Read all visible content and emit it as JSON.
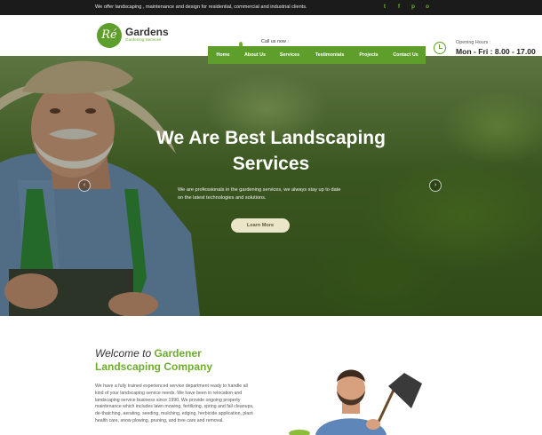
{
  "topbar": {
    "message": "We offer landscaping , maintenance and design for residential, commercial and industrial clients.",
    "social_icons": [
      "twitter-icon",
      "facebook-icon",
      "pinterest-icon",
      "instagram-icon"
    ],
    "social_glyphs": [
      "t",
      "f",
      "p",
      "o"
    ]
  },
  "header": {
    "logo_letters": "Ré",
    "logo_name": "Gardens",
    "logo_tagline": "Gardening Services",
    "call_label": "Call us now :",
    "opening_label": "Opening Hours :",
    "opening_hours": "Mon - Fri : 8.00 - 17.00"
  },
  "nav": {
    "items": [
      "Home",
      "About Us",
      "Services",
      "Testimonials",
      "Projects",
      "Contact Us"
    ]
  },
  "hero": {
    "title_line1": "We Are Best Landscaping",
    "title_line2": "Services",
    "text": "We are professionals in the gardening services, we always stay up to date on the latest technologies and solutions.",
    "button": "Learn More",
    "prev_glyph": "‹",
    "next_glyph": "›"
  },
  "welcome": {
    "line1_prefix": "Welcome to ",
    "line1_accent": "Gardener",
    "line2": "Landscaping Company",
    "text": "We have a fully trained experienced service department ready to handle all kind of your landscaping service needs. We have been in relocation and landscaping service business since 1990. We provide ongoing property maintenance which includes lawn mowing, fertilizing, spring and fall cleanups, de-thatching, aerating, seeding, mulching, edging, herbicide application, plant health care, snow plowing, pruning, and tree care and removal."
  },
  "colors": {
    "accent": "#5e9e2a",
    "topbar": "#1b1b1b",
    "button": "#ece6c9"
  }
}
